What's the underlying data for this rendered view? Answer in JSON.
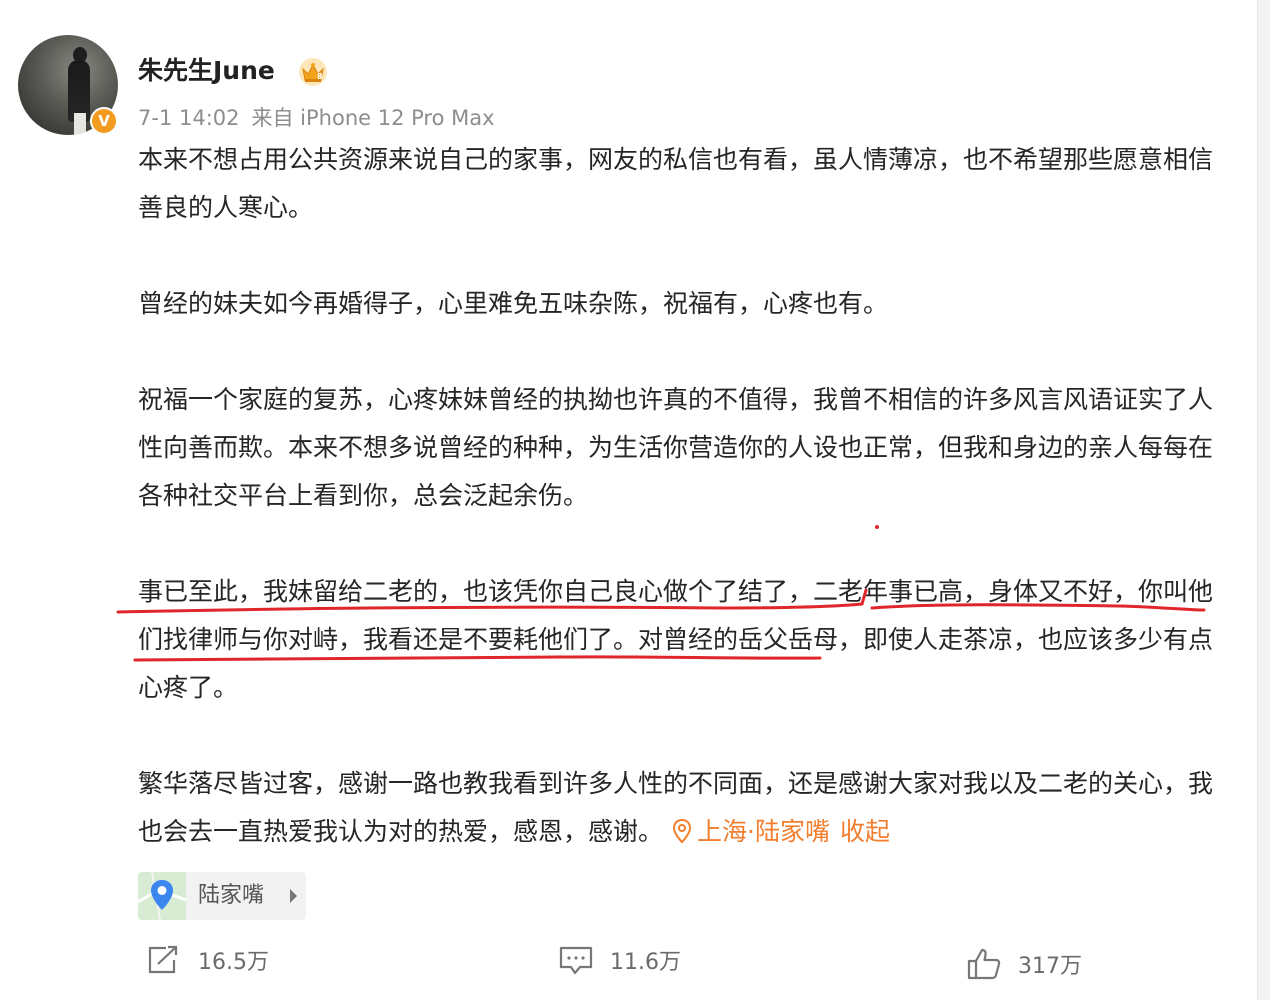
{
  "author": {
    "name": "朱先生June",
    "verified_badge": "V",
    "avatar_icon": "avatar-photo",
    "crown_icon": "crown-icon"
  },
  "meta": {
    "time": "7-1 14:02",
    "source": "来自 iPhone 12 Pro Max"
  },
  "post": {
    "paragraphs": [
      "本来不想占用公共资源来说自己的家事，网友的私信也有看，虽人情薄凉，也不希望那些愿意相信善良的人寒心。",
      "曾经的妹夫如今再婚得子，心里难免五味杂陈，祝福有，心疼也有。",
      "祝福一个家庭的复苏，心疼妹妹曾经的执拗也许真的不值得，我曾不相信的许多风言风语证实了人性向善而欺。本来不想多说曾经的种种，为生活你营造你的人设也正常，但我和身边的亲人每每在各种社交平台上看到你，总会泛起余伤。",
      "事已至此，我妹留给二老的，也该凭你自己良心做个了结了，二老年事已高，身体又不好，你叫他们找律师与你对峙，我看还是不要耗他们了。对曾经的岳父岳母，即使人走茶凉，也应该多少有点心疼了。",
      "繁华落尽皆过客，感谢一路也教我看到许多人性的不同面，还是感谢大家对我以及二老的关心，我也会去一直热爱我认为对的热爱，感恩，感谢。"
    ],
    "location_inline": "上海·陆家嘴",
    "collapse_label": "收起"
  },
  "place_card": {
    "label": "陆家嘴"
  },
  "actions": {
    "repost_count": "16.5万",
    "comment_count": "11.6万",
    "like_count": "317万"
  },
  "colors": {
    "accent": "#f27e2e",
    "meta_gray": "#8d8d8d",
    "annotation_red": "#e0262a",
    "verified_orange": "#f29c1f"
  }
}
